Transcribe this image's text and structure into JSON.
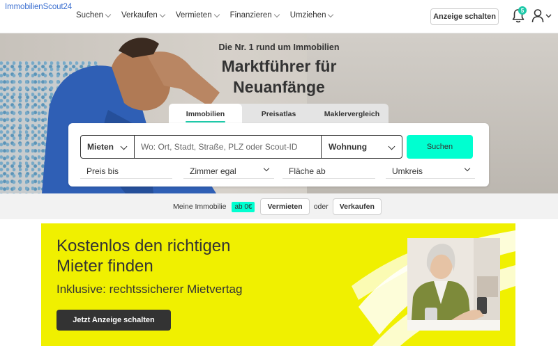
{
  "header": {
    "logo": "ImmobilienScout24",
    "nav": [
      "Suchen",
      "Verkaufen",
      "Vermieten",
      "Finanzieren",
      "Umziehen"
    ],
    "cta_label": "Anzeige schalten",
    "notification_count": "5"
  },
  "hero": {
    "subtitle": "Die Nr. 1 rund um Immobilien",
    "title_line1": "Marktführer für",
    "title_line2": "Neuanfänge"
  },
  "search": {
    "tabs": [
      "Immobilien",
      "Preisatlas",
      "Maklervergleich"
    ],
    "active_tab": "Immobilien",
    "type_value": "Mieten",
    "where_placeholder": "Wo: Ort, Stadt, Straße, PLZ oder Scout-ID",
    "property_value": "Wohnung",
    "submit_label": "Suchen",
    "filters": {
      "price": "Preis bis",
      "rooms": "Zimmer egal",
      "area": "Fläche ab",
      "radius": "Umkreis"
    }
  },
  "owner_strip": {
    "label": "Meine Immobilie",
    "badge": "ab 0€",
    "rent_label": "Vermieten",
    "or": "oder",
    "sell_label": "Verkaufen"
  },
  "ad": {
    "headline_line1": "Kostenlos den richtigen",
    "headline_line2": "Mieter finden",
    "subline": "Inklusive: rechtssicherer Mietvertag",
    "button_label": "Jetzt Anzeige schalten"
  },
  "colors": {
    "accent": "#00ffd0",
    "badge": "#1ec9a9",
    "ad_background": "#f0f000",
    "logo": "#3b6fd0"
  }
}
